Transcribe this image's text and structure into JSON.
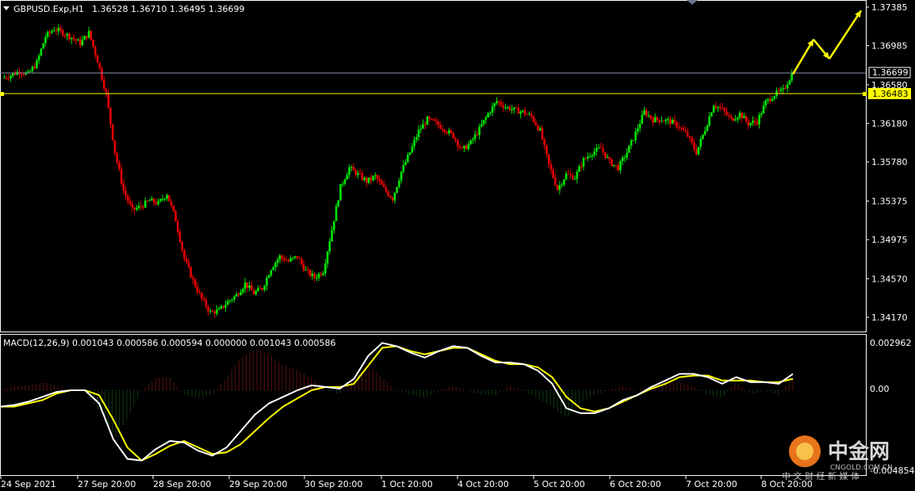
{
  "header": {
    "symbol_label": "GBPUSD.Exp,H1",
    "ohlc_label": "1.36528 1.36710 1.36495 1.36699"
  },
  "macd_panel": {
    "label": "MACD(12,26,9) 0.001043 0.000586 0.000594 0.000000 0.001043 0.000586",
    "top_label": "0.002962",
    "zero_label": "0.00",
    "bottom_label": "-0.004854"
  },
  "price_scale": {
    "labels": [
      "1.37385",
      "1.36985",
      "1.36580",
      "1.36180",
      "1.35780",
      "1.35375",
      "1.34975",
      "1.34570",
      "1.34170"
    ],
    "current_price": "1.36699",
    "level_price": "1.36483"
  },
  "time_axis": {
    "labels": [
      "24 Sep 2021",
      "27 Sep 20:00",
      "28 Sep 20:00",
      "29 Sep 20:00",
      "30 Sep 20:00",
      "1 Oct 20:00",
      "4 Oct 20:00",
      "5 Oct 20:00",
      "6 Oct 20:00",
      "7 Oct 20:00",
      "8 Oct 20:00"
    ]
  },
  "watermark": {
    "brand": "中金网",
    "domain": "CNGOLD.COM.CN",
    "tagline": "中 文 财 经 新 媒 体"
  },
  "colors": {
    "bull": "#00e600",
    "bear": "#e60000",
    "level_line": "#ffff00",
    "current_line": "#8a8fa8",
    "signal_line": "#ffff00",
    "macd_line": "#ffffff",
    "hist_pos": "#b22222",
    "hist_neg": "#1f7a1f",
    "arrow": "#ffff00"
  },
  "chart_data": {
    "type": "candlestick",
    "symbol": "GBPUSD.Exp",
    "timeframe": "H1",
    "ylim": [
      1.3403,
      1.3752
    ],
    "y_ticks": [
      1.37385,
      1.36985,
      1.3658,
      1.3618,
      1.3578,
      1.35375,
      1.34975,
      1.3457,
      1.3417
    ],
    "horizontal_lines": [
      1.36699,
      1.36483
    ],
    "close_path": [
      1.3665,
      1.3668,
      1.3672,
      1.3669,
      1.3681,
      1.3708,
      1.3716,
      1.3712,
      1.3707,
      1.3701,
      1.3712,
      1.3683,
      1.3648,
      1.3588,
      1.3548,
      1.3528,
      1.3532,
      1.3538,
      1.3535,
      1.3545,
      1.3518,
      1.3478,
      1.3455,
      1.3436,
      1.3422,
      1.3424,
      1.3433,
      1.344,
      1.3452,
      1.3442,
      1.3447,
      1.3468,
      1.348,
      1.3475,
      1.348,
      1.3465,
      1.3458,
      1.3465,
      1.3508,
      1.3552,
      1.3572,
      1.3565,
      1.3558,
      1.3563,
      1.355,
      1.354,
      1.3568,
      1.3588,
      1.361,
      1.3622,
      1.3618,
      1.3612,
      1.3605,
      1.359,
      1.3598,
      1.3612,
      1.3628,
      1.3641,
      1.3635,
      1.3632,
      1.363,
      1.3625,
      1.361,
      1.3575,
      1.355,
      1.3565,
      1.3562,
      1.358,
      1.3588,
      1.3592,
      1.3578,
      1.3572,
      1.3588,
      1.3608,
      1.363,
      1.3622,
      1.3622,
      1.362,
      1.3615,
      1.3605,
      1.3588,
      1.3612,
      1.3638,
      1.3632,
      1.3622,
      1.3628,
      1.3618,
      1.362,
      1.364,
      1.3648,
      1.3652,
      1.3669
    ],
    "projection_arrow": [
      [
        1.3669,
        1.3705
      ],
      [
        1.3705,
        1.3685
      ],
      [
        1.3685,
        1.3735
      ]
    ],
    "macd": {
      "params": "12,26,9",
      "ylim": [
        -0.004854,
        0.002962
      ],
      "main": [
        -0.001,
        -0.0009,
        -0.0007,
        -0.0004,
        -0.0001,
        0.0,
        0.0,
        -0.0008,
        -0.003,
        -0.0042,
        -0.0043,
        -0.0036,
        -0.0031,
        -0.0032,
        -0.0037,
        -0.004,
        -0.0035,
        -0.0025,
        -0.0015,
        -0.0008,
        -0.0004,
        0.0,
        0.0003,
        0.0002,
        0.0001,
        0.0007,
        0.0021,
        0.0029,
        0.0027,
        0.0023,
        0.002,
        0.0024,
        0.0027,
        0.0026,
        0.0021,
        0.0017,
        0.0017,
        0.0016,
        0.0012,
        0.0004,
        -0.0011,
        -0.0014,
        -0.0014,
        -0.0011,
        -0.0006,
        -0.0003,
        0.0002,
        0.0006,
        0.001,
        0.001,
        0.0008,
        0.0004,
        0.0008,
        0.0005,
        0.0005,
        0.0004,
        0.001
      ],
      "signal": [
        -0.001,
        -0.001,
        -0.0008,
        -0.0006,
        -0.0002,
        0.0,
        0.0,
        -0.0003,
        -0.0018,
        -0.0035,
        -0.0043,
        -0.0039,
        -0.0034,
        -0.0031,
        -0.0035,
        -0.0039,
        -0.0038,
        -0.0033,
        -0.0025,
        -0.0017,
        -0.001,
        -0.0005,
        0.0,
        0.0002,
        0.0002,
        0.0004,
        0.0015,
        0.0026,
        0.0027,
        0.0024,
        0.0022,
        0.0024,
        0.0026,
        0.0026,
        0.0022,
        0.0018,
        0.0016,
        0.0016,
        0.0014,
        0.0008,
        -0.0004,
        -0.0011,
        -0.0013,
        -0.0011,
        -0.0007,
        -0.0003,
        0.0001,
        0.0004,
        0.0008,
        0.0009,
        0.0009,
        0.0006,
        0.0006,
        0.0006,
        0.0005,
        0.0005,
        0.0007
      ]
    }
  }
}
